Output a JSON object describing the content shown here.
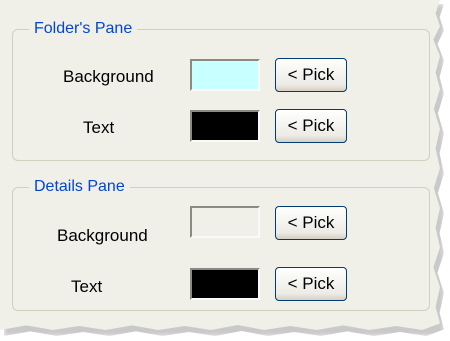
{
  "folders_pane": {
    "title": "Folder's Pane",
    "background_label": "Background",
    "background_color": "#c8ffff",
    "text_label": "Text",
    "text_color": "#000000",
    "pick_label": "< Pick"
  },
  "details_pane": {
    "title": "Details Pane",
    "background_label": "Background",
    "background_color": "#f0efe8",
    "text_label": "Text",
    "text_color": "#000000",
    "pick_label": "< Pick"
  }
}
